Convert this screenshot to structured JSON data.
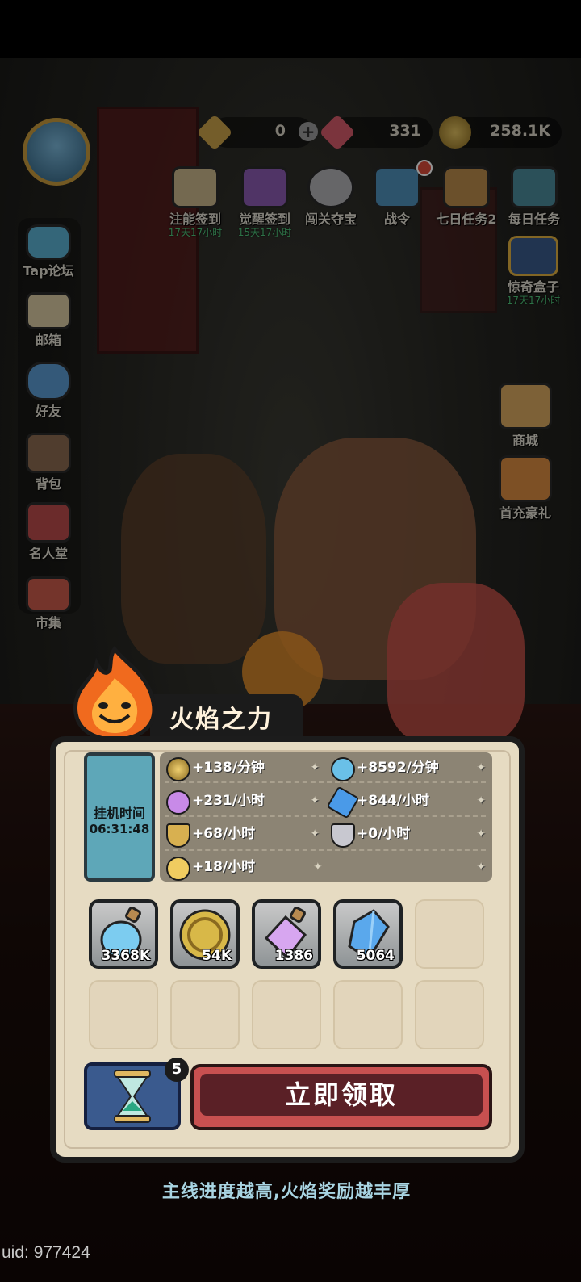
{
  "currency": [
    {
      "name": "gold-gem",
      "value": "0",
      "color": "#c9a049"
    },
    {
      "name": "red-gem",
      "value": "331",
      "color": "#d45a6a"
    },
    {
      "name": "coin",
      "value": "258.1K",
      "color": "#c8a84a"
    }
  ],
  "top_menu": [
    {
      "label": "注能签到",
      "sub": "17天17小时"
    },
    {
      "label": "觉醒签到",
      "sub": "15天17小时"
    },
    {
      "label": "闯关夺宝",
      "sub": ""
    },
    {
      "label": "战令",
      "sub": ""
    },
    {
      "label": "七日任务2",
      "sub": ""
    },
    {
      "label": "每日任务",
      "sub": ""
    }
  ],
  "right_menu": [
    {
      "label": "惊奇盒子",
      "sub": "17天17小时"
    },
    {
      "label": "商城",
      "sub": ""
    },
    {
      "label": "首充豪礼",
      "sub": ""
    }
  ],
  "left_menu": [
    {
      "label": "Tap论坛"
    },
    {
      "label": "邮箱"
    },
    {
      "label": "好友"
    },
    {
      "label": "背包"
    },
    {
      "label": "名人堂"
    },
    {
      "label": "市集"
    }
  ],
  "panel": {
    "title": "火焰之力",
    "idle_label": "挂机时间",
    "idle_time": "06:31:48",
    "rates": [
      {
        "text": "+138/分钟",
        "icon": "coin-icon"
      },
      {
        "text": "+8592/分钟",
        "icon": "blue-potion-icon"
      },
      {
        "text": "+231/小时",
        "icon": "purple-potion-icon"
      },
      {
        "text": "+844/小时",
        "icon": "crystal-icon"
      },
      {
        "text": "+68/小时",
        "icon": "goblet-icon"
      },
      {
        "text": "+0/小时",
        "icon": "silver-goblet-icon"
      },
      {
        "text": "+18/小时",
        "icon": "heart-icon"
      }
    ],
    "rewards": [
      {
        "qty": "3368K",
        "icon": "blue-potion-icon"
      },
      {
        "qty": "54K",
        "icon": "coin-icon"
      },
      {
        "qty": "1386",
        "icon": "purple-potion-icon"
      },
      {
        "qty": "5064",
        "icon": "crystal-icon"
      }
    ],
    "hourglass_count": "5",
    "claim_label": "立即领取",
    "hint": "主线进度越高,火焰奖励越丰厚"
  },
  "uid": "uid: 977424"
}
